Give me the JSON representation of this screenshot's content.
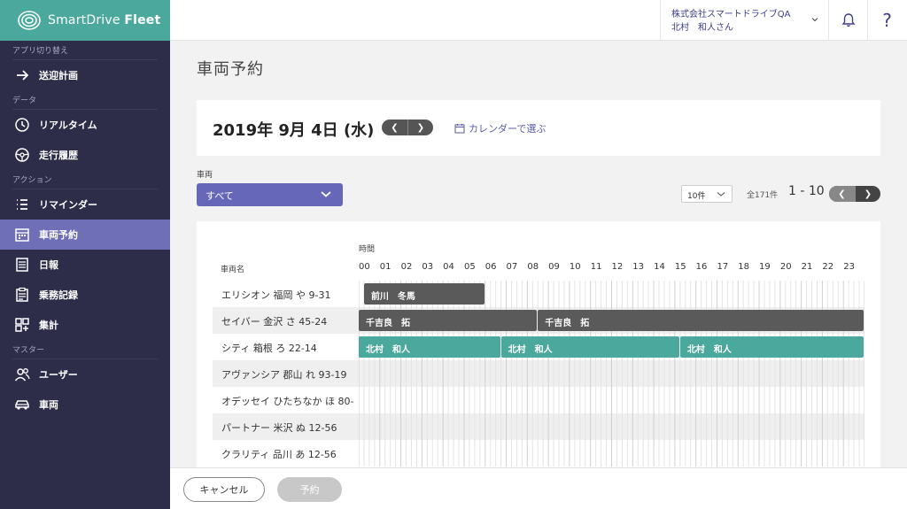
{
  "app": {
    "logo_text_regular": "SmartDrive",
    "logo_text_bold": "Fleet"
  },
  "sidebar": {
    "sections": [
      {
        "label": "アプリ切り替え",
        "items": [
          {
            "label": "送迎計画",
            "icon": "arrow-right-icon",
            "active": false
          }
        ]
      },
      {
        "label": "データ",
        "items": [
          {
            "label": "リアルタイム",
            "icon": "clock-icon",
            "active": false
          },
          {
            "label": "走行履歴",
            "icon": "steering-wheel-icon",
            "active": false
          }
        ]
      },
      {
        "label": "アクション",
        "items": [
          {
            "label": "リマインダー",
            "icon": "list-icon",
            "active": false
          },
          {
            "label": "車両予約",
            "icon": "calendar-icon",
            "active": true
          },
          {
            "label": "日報",
            "icon": "report-icon",
            "active": false
          },
          {
            "label": "乗務記録",
            "icon": "clipboard-icon",
            "active": false
          },
          {
            "label": "集計",
            "icon": "grid-icon",
            "active": false
          }
        ]
      },
      {
        "label": "マスター",
        "items": [
          {
            "label": "ユーザー",
            "icon": "users-icon",
            "active": false
          },
          {
            "label": "車両",
            "icon": "car-icon",
            "active": false
          }
        ]
      }
    ]
  },
  "header": {
    "company": "株式会社スマートドライブQA",
    "user": "北村　和人さん"
  },
  "page": {
    "title": "車両予約",
    "date": "2019年 9月 4日 (水)",
    "calendar_link": "カレンダーで選ぶ",
    "vehicle_label": "車両",
    "vehicle_select": "すべて",
    "per_page": "10件",
    "total": "全171件",
    "range": "1 - 10"
  },
  "schedule": {
    "time_label": "時間",
    "name_header": "車両名",
    "hours": [
      "00",
      "01",
      "02",
      "03",
      "04",
      "05",
      "06",
      "07",
      "08",
      "09",
      "10",
      "11",
      "12",
      "13",
      "14",
      "15",
      "16",
      "17",
      "18",
      "19",
      "20",
      "21",
      "22",
      "23"
    ],
    "rows": [
      {
        "name": "エリシオン 福岡 や 9-31",
        "bookings": [
          {
            "label": "前川　冬馬",
            "start": 0.25,
            "end": 6.0,
            "color": "gray"
          }
        ]
      },
      {
        "name": "セイバー 金沢 さ 45-24",
        "bookings": [
          {
            "label": "千吉良　拓",
            "start": 0.0,
            "end": 8.5,
            "color": "gray"
          },
          {
            "label": "千吉良　拓",
            "start": 8.5,
            "end": 24.0,
            "color": "gray"
          }
        ]
      },
      {
        "name": "シティ 箱根 ろ 22-14",
        "bookings": [
          {
            "label": "北村　和人",
            "start": 0.0,
            "end": 6.75,
            "color": "teal"
          },
          {
            "label": "北村　和人",
            "start": 6.75,
            "end": 15.25,
            "color": "teal"
          },
          {
            "label": "北村　和人",
            "start": 15.25,
            "end": 24.0,
            "color": "teal"
          }
        ]
      },
      {
        "name": "アヴァンシア 郡山 れ 93-19",
        "bookings": []
      },
      {
        "name": "オデッセイ ひたちなか ほ 80-",
        "bookings": []
      },
      {
        "name": "パートナー 米沢 ぬ 12-56",
        "bookings": []
      },
      {
        "name": "クラリティ 品川 あ 12-56",
        "bookings": []
      }
    ]
  },
  "footer": {
    "cancel": "キャンセル",
    "reserve": "予約"
  },
  "colors": {
    "brand_teal": "#4aa99c",
    "sidebar_bg": "#2d2d49",
    "accent_purple": "#6767b9",
    "booking_gray": "#5a5a5a"
  }
}
